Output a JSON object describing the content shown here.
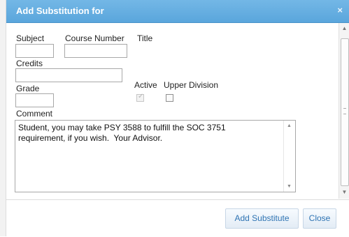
{
  "dialog": {
    "title": "Add Substitution for",
    "close_glyph": "×"
  },
  "form": {
    "subject_label": "Subject",
    "subject_value": "",
    "course_number_label": "Course Number",
    "course_number_value": "",
    "title_label": "Title",
    "credits_label": "Credits",
    "credits_value": "",
    "grade_label": "Grade",
    "grade_value": "",
    "active_label": "Active",
    "active_checked": true,
    "upper_division_label": "Upper Division",
    "upper_division_checked": false,
    "comment_label": "Comment",
    "comment_value": "Student, you may take PSY 3588 to fulfill the SOC 3751\nrequirement, if you wish.  Your Advisor."
  },
  "footer": {
    "add_label": "Add Substitute",
    "close_label": "Close"
  },
  "colors": {
    "title_bar": "#5aa6dc",
    "button_text": "#2f74b3"
  }
}
